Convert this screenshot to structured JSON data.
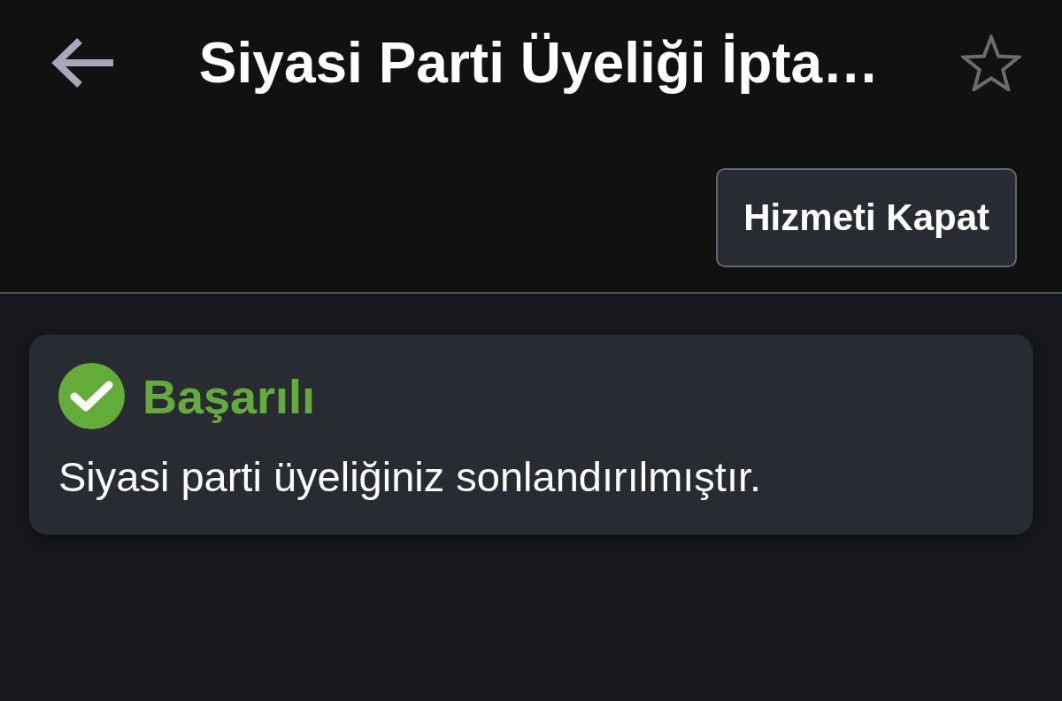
{
  "header": {
    "title": "Siyasi Parti Üyeliği İpta…",
    "starred": false
  },
  "action_button": {
    "label": "Hizmeti Kapat"
  },
  "alert": {
    "kind": "success",
    "title": "Başarılı",
    "message": "Siyasi parti üyeliğiniz sonlandırılmıştır."
  }
}
